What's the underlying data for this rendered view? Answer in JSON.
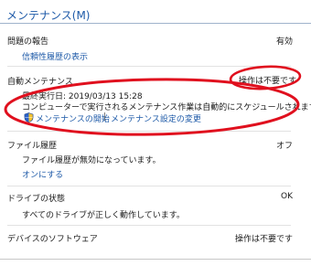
{
  "header": {
    "title": "メンテナンス(M)"
  },
  "problem_reports": {
    "label": "問題の報告",
    "status": "有効",
    "link": "信頼性履歴の表示"
  },
  "auto_maintenance": {
    "label": "自動メンテナンス",
    "status": "操作は不要です",
    "last_run": "最終実行日: 2019/03/13 15:28",
    "description": "コンピューターで実行されるメンテナンス作業は自動的にスケジュールされます。",
    "start_link": "メンテナンスの開始",
    "divider": "|",
    "settings_link": "メンテナンス設定の変更"
  },
  "file_history": {
    "label": "ファイル履歴",
    "status": "オフ",
    "description": "ファイル履歴が無効になっています。",
    "link": "オンにする"
  },
  "drive_status": {
    "label": "ドライブの状態",
    "status": "OK",
    "description": "すべてのドライブが正しく動作しています。"
  },
  "device_software": {
    "label": "デバイスのソフトウェア",
    "status": "操作は不要です"
  },
  "colors": {
    "link": "#1e5aa8",
    "annotation": "#e0101e"
  }
}
